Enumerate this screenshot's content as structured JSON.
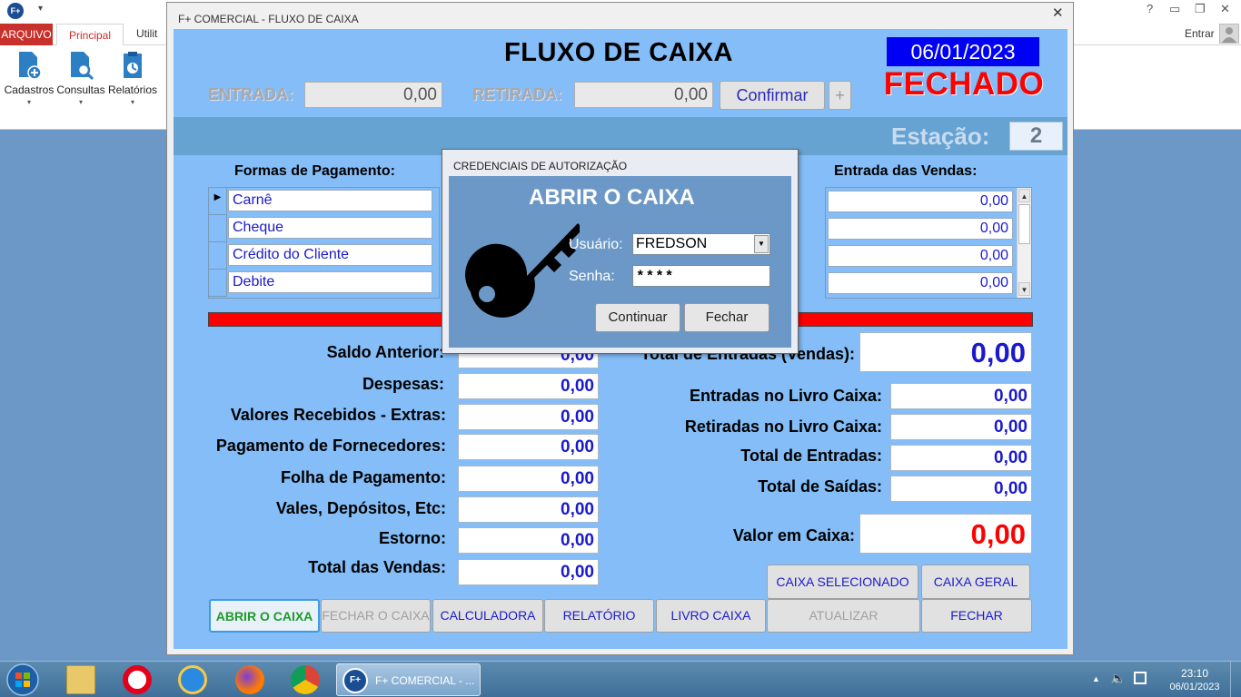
{
  "host_app": {
    "logo_text": "F+",
    "tabs": [
      "ARQUIVO",
      "Principal",
      "Utilit"
    ],
    "entrar": "Entrar",
    "help": "?",
    "ribbon": [
      {
        "label": "Cadastros",
        "icon": "document-add-icon"
      },
      {
        "label": "Consultas",
        "icon": "document-search-icon"
      },
      {
        "label": "Relatórios",
        "icon": "report-icon"
      }
    ],
    "colors": {
      "arquivo_tab": "#c8302c",
      "principal_tab_text": "#c8302c"
    }
  },
  "window": {
    "title": "F+ COMERCIAL - FLUXO DE CAIXA",
    "close": "✕",
    "header": {
      "title": "FLUXO DE CAIXA",
      "date": "06/01/2023",
      "status": "FECHADO",
      "entrada_label": "ENTRADA:",
      "entrada_value": "0,00",
      "retirada_label": "RETIRADA:",
      "retirada_value": "0,00",
      "confirmar": "Confirmar",
      "plus": "+",
      "estacao_label": "Estação:",
      "estacao_value": "2"
    },
    "payment": {
      "formas_header": "Formas de Pagamento:",
      "entrada_header": "Entrada das Vendas:",
      "methods": [
        "Carnê",
        "Cheque",
        "Crédito do Cliente",
        "Debite"
      ],
      "values": [
        "0,00",
        "0,00",
        "0,00",
        "0,00"
      ],
      "selected_indicator": "▶"
    },
    "left_fields": [
      {
        "label": "Saldo Anterior:",
        "value": "0,00"
      },
      {
        "label": "Despesas:",
        "value": "0,00"
      },
      {
        "label": "Valores Recebidos - Extras:",
        "value": "0,00"
      },
      {
        "label": "Pagamento de Fornecedores:",
        "value": "0,00"
      },
      {
        "label": "Folha de Pagamento:",
        "value": "0,00"
      },
      {
        "label": "Vales, Depósitos, Etc:",
        "value": "0,00"
      },
      {
        "label": "Estorno:",
        "value": "0,00"
      },
      {
        "label": "Total das Vendas:",
        "value": "0,00"
      }
    ],
    "right_fields": {
      "total_entradas_vendas_label": "Total de Entradas (Vendas):",
      "total_entradas_vendas_value": "0,00",
      "entradas_livro_label": "Entradas no Livro Caixa:",
      "entradas_livro_value": "0,00",
      "retiradas_livro_label": "Retiradas no Livro Caixa:",
      "retiradas_livro_value": "0,00",
      "total_entradas_label": "Total de Entradas:",
      "total_entradas_value": "0,00",
      "total_saidas_label": "Total de Saídas:",
      "total_saidas_value": "0,00",
      "valor_caixa_label": "Valor em Caixa:",
      "valor_caixa_value": "0,00"
    },
    "caixa_buttons": {
      "selecionado": "CAIXA SELECIONADO",
      "geral": "CAIXA GERAL"
    },
    "bottom_buttons": [
      "ABRIR O CAIXA",
      "FECHAR O CAIXA",
      "CALCULADORA",
      "RELATÓRIO",
      "LIVRO CAIXA",
      "ATUALIZAR",
      "FECHAR"
    ],
    "colors": {
      "client_bg": "#84bdf7",
      "date_bg": "#0000f5",
      "status": "#ff0000",
      "red_bar": "#ff0000",
      "value_blue": "#1a1acc",
      "valor_caixa": "#ff0000"
    }
  },
  "auth_dialog": {
    "title": "CREDENCIAIS DE AUTORIZAÇÃO",
    "heading": "ABRIR O CAIXA",
    "usuario_label": "Usuário:",
    "usuario_value": "FREDSON",
    "senha_label": "Senha:",
    "senha_value": "****",
    "continuar": "Continuar",
    "fechar": "Fechar",
    "icon": "key-icon"
  },
  "taskbar": {
    "active_task_label": "F+ COMERCIAL - ...",
    "active_task_icon_text": "F+",
    "pinned": [
      "file-explorer-icon",
      "opera-icon",
      "internet-explorer-icon",
      "firefox-icon",
      "chrome-icon"
    ],
    "time": "23:10",
    "date": "06/01/2023"
  }
}
